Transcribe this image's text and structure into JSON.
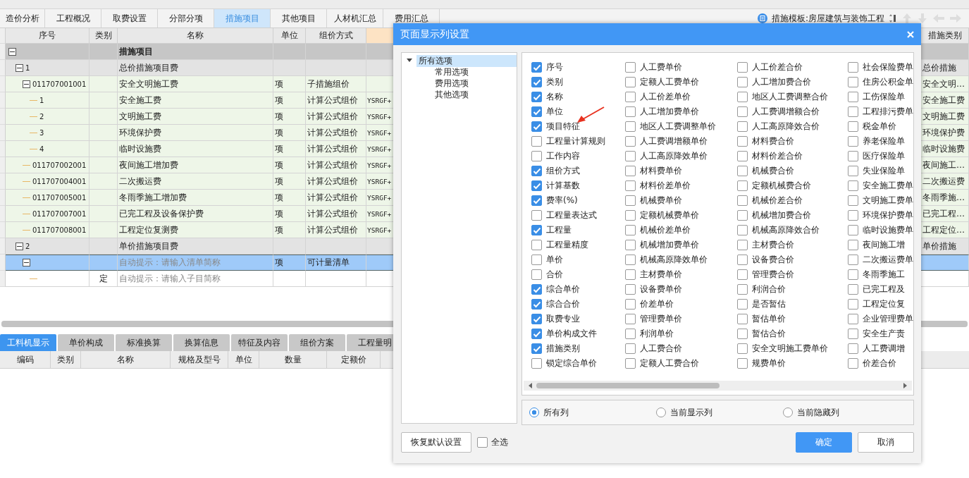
{
  "tabs": [
    {
      "label": "造价分析",
      "selected": false
    },
    {
      "label": "工程概况",
      "selected": false
    },
    {
      "label": "取费设置",
      "selected": false
    },
    {
      "label": "分部分项",
      "selected": false
    },
    {
      "label": "措施项目",
      "selected": true
    },
    {
      "label": "其他项目",
      "selected": false
    },
    {
      "label": "人材机汇总",
      "selected": false
    },
    {
      "label": "费用汇总",
      "selected": false
    }
  ],
  "template": {
    "label": "措施模板:房屋建筑与装饰工程"
  },
  "table": {
    "columns": [
      "序号",
      "类别",
      "名称",
      "单位",
      "组价方式",
      "措施类别"
    ],
    "rows": [
      {
        "name": "措施项目",
        "kind": "section",
        "expanded": true,
        "selected": false,
        "children": [
          {
            "seq": "1",
            "name": "总价措施项目费",
            "category": "总价措施",
            "kind": "group",
            "expanded": true,
            "selected": false,
            "children": [
              {
                "seq": "011707001001",
                "name": "安全文明施工费",
                "unit": "项",
                "method": "子措施组价",
                "category": "安全文明…",
                "kind": "item",
                "expanded": true,
                "selected": false,
                "children": [
                  {
                    "seq": "1",
                    "name": "安全施工费",
                    "unit": "项",
                    "method": "计算公式组价",
                    "formula": "YSRGF+",
                    "category": "安全施工费",
                    "kind": "item",
                    "selected": false
                  },
                  {
                    "seq": "2",
                    "name": "文明施工费",
                    "unit": "项",
                    "method": "计算公式组价",
                    "formula": "YSRGF+",
                    "category": "文明施工费",
                    "kind": "item",
                    "selected": false
                  },
                  {
                    "seq": "3",
                    "name": "环境保护费",
                    "unit": "项",
                    "method": "计算公式组价",
                    "formula": "YSRGF+",
                    "category": "环境保护费",
                    "kind": "item",
                    "selected": false
                  },
                  {
                    "seq": "4",
                    "name": "临时设施费",
                    "unit": "项",
                    "method": "计算公式组价",
                    "formula": "YSRGF+",
                    "category": "临时设施费",
                    "kind": "item",
                    "selected": false
                  }
                ]
              },
              {
                "seq": "011707002001",
                "name": "夜间施工增加费",
                "unit": "项",
                "method": "计算公式组价",
                "formula": "YSRGF+",
                "category": "夜间施工…",
                "kind": "item",
                "selected": false
              },
              {
                "seq": "011707004001",
                "name": "二次搬运费",
                "unit": "项",
                "method": "计算公式组价",
                "formula": "YSRGF+",
                "category": "二次搬运费",
                "kind": "item",
                "selected": false
              },
              {
                "seq": "011707005001",
                "name": "冬雨季施工增加费",
                "unit": "项",
                "method": "计算公式组价",
                "formula": "YSRGF+",
                "category": "冬雨季施…",
                "kind": "item",
                "selected": false
              },
              {
                "seq": "011707007001",
                "name": "已完工程及设备保护费",
                "unit": "项",
                "method": "计算公式组价",
                "formula": "YSRGF+",
                "category": "已完工程…",
                "kind": "item",
                "selected": false
              },
              {
                "seq": "011707008001",
                "name": "工程定位复测费",
                "unit": "项",
                "method": "计算公式组价",
                "formula": "YSRGF+",
                "category": "工程定位…",
                "kind": "item",
                "selected": false
              }
            ]
          },
          {
            "seq": "2",
            "name": "单价措施项目费",
            "category": "单价措施",
            "kind": "group",
            "expanded": true,
            "selected": false,
            "children": [
              {
                "placeholder": "自动提示：请输入清单简称",
                "unit": "项",
                "method": "可计量清单",
                "kind": "entry",
                "expanded": true,
                "selected": true,
                "children": [
                  {
                    "type": "定",
                    "placeholder": "自动提示：请输入子目简称",
                    "kind": "entry",
                    "selected": false
                  }
                ]
              }
            ]
          }
        ]
      }
    ]
  },
  "bottom_tabs": [
    {
      "label": "工料机显示",
      "selected": true
    },
    {
      "label": "单价构成",
      "selected": false
    },
    {
      "label": "标准换算",
      "selected": false
    },
    {
      "label": "换算信息",
      "selected": false
    },
    {
      "label": "特征及内容",
      "selected": false
    },
    {
      "label": "组价方案",
      "selected": false
    },
    {
      "label": "工程量明",
      "selected": false
    }
  ],
  "bottom_columns": [
    "编码",
    "类别",
    "名称",
    "规格及型号",
    "单位",
    "数量",
    "定额价"
  ],
  "dialog": {
    "title": "页面显示列设置",
    "tree": [
      {
        "label": "所有选项",
        "expanded": true,
        "selected": true,
        "children": [
          {
            "label": "常用选项",
            "selected": false
          },
          {
            "label": "费用选项",
            "selected": false
          },
          {
            "label": "其他选项",
            "selected": false
          }
        ]
      }
    ],
    "option_columns": [
      {
        "items": [
          {
            "label": "序号",
            "checked": true
          },
          {
            "label": "类别",
            "checked": true
          },
          {
            "label": "名称",
            "checked": true
          },
          {
            "label": "单位",
            "checked": true
          },
          {
            "label": "项目特征",
            "checked": true
          },
          {
            "label": "工程量计算规则",
            "checked": false
          },
          {
            "label": "工作内容",
            "checked": false
          },
          {
            "label": "组价方式",
            "checked": true
          },
          {
            "label": "计算基数",
            "checked": true
          },
          {
            "label": "费率(%)",
            "checked": true
          },
          {
            "label": "工程量表达式",
            "checked": false
          },
          {
            "label": "工程量",
            "checked": true
          },
          {
            "label": "工程量精度",
            "checked": false
          },
          {
            "label": "单价",
            "checked": false
          },
          {
            "label": "合价",
            "checked": false
          },
          {
            "label": "综合单价",
            "checked": true
          },
          {
            "label": "综合合价",
            "checked": true
          },
          {
            "label": "取费专业",
            "checked": true
          },
          {
            "label": "单价构成文件",
            "checked": true
          },
          {
            "label": "措施类别",
            "checked": true
          },
          {
            "label": "锁定综合单价",
            "checked": false
          }
        ]
      },
      {
        "items": [
          {
            "label": "人工费单价",
            "checked": false
          },
          {
            "label": "定额人工费单价",
            "checked": false
          },
          {
            "label": "人工价差单价",
            "checked": false
          },
          {
            "label": "人工增加费单价",
            "checked": false
          },
          {
            "label": "地区人工费调整单价",
            "checked": false
          },
          {
            "label": "人工费调增额单价",
            "checked": false
          },
          {
            "label": "人工高原降效单价",
            "checked": false
          },
          {
            "label": "材料费单价",
            "checked": false
          },
          {
            "label": "材料价差单价",
            "checked": false
          },
          {
            "label": "机械费单价",
            "checked": false
          },
          {
            "label": "定额机械费单价",
            "checked": false
          },
          {
            "label": "机械价差单价",
            "checked": false
          },
          {
            "label": "机械增加费单价",
            "checked": false
          },
          {
            "label": "机械高原降效单价",
            "checked": false
          },
          {
            "label": "主材费单价",
            "checked": false
          },
          {
            "label": "设备费单价",
            "checked": false
          },
          {
            "label": "价差单价",
            "checked": false
          },
          {
            "label": "管理费单价",
            "checked": false
          },
          {
            "label": "利润单价",
            "checked": false
          },
          {
            "label": "人工费合价",
            "checked": false
          },
          {
            "label": "定额人工费合价",
            "checked": false
          }
        ]
      },
      {
        "items": [
          {
            "label": "人工价差合价",
            "checked": false
          },
          {
            "label": "人工增加费合价",
            "checked": false
          },
          {
            "label": "地区人工费调整合价",
            "checked": false
          },
          {
            "label": "人工费调增额合价",
            "checked": false
          },
          {
            "label": "人工高原降效合价",
            "checked": false
          },
          {
            "label": "材料费合价",
            "checked": false
          },
          {
            "label": "材料价差合价",
            "checked": false
          },
          {
            "label": "机械费合价",
            "checked": false
          },
          {
            "label": "定额机械费合价",
            "checked": false
          },
          {
            "label": "机械价差合价",
            "checked": false
          },
          {
            "label": "机械增加费合价",
            "checked": false
          },
          {
            "label": "机械高原降效合价",
            "checked": false
          },
          {
            "label": "主材费合价",
            "checked": false
          },
          {
            "label": "设备费合价",
            "checked": false
          },
          {
            "label": "管理费合价",
            "checked": false
          },
          {
            "label": "利润合价",
            "checked": false
          },
          {
            "label": "是否暂估",
            "checked": false
          },
          {
            "label": "暂估单价",
            "checked": false
          },
          {
            "label": "暂估合价",
            "checked": false
          },
          {
            "label": "安全文明施工费单价",
            "checked": false
          },
          {
            "label": "规费单价",
            "checked": false
          }
        ]
      },
      {
        "items": [
          {
            "label": "社会保险费单",
            "checked": false
          },
          {
            "label": "住房公积金单",
            "checked": false
          },
          {
            "label": "工伤保险单",
            "checked": false
          },
          {
            "label": "工程排污费单",
            "checked": false
          },
          {
            "label": "税金单价",
            "checked": false
          },
          {
            "label": "养老保险单",
            "checked": false
          },
          {
            "label": "医疗保险单",
            "checked": false
          },
          {
            "label": "失业保险单",
            "checked": false
          },
          {
            "label": "安全施工费单",
            "checked": false
          },
          {
            "label": "文明施工费单",
            "checked": false
          },
          {
            "label": "环境保护费单",
            "checked": false
          },
          {
            "label": "临时设施费单",
            "checked": false
          },
          {
            "label": "夜间施工增",
            "checked": false
          },
          {
            "label": "二次搬运费单",
            "checked": false
          },
          {
            "label": "冬雨季施工",
            "checked": false
          },
          {
            "label": "已完工程及",
            "checked": false
          },
          {
            "label": "工程定位复",
            "checked": false
          },
          {
            "label": "企业管理费单",
            "checked": false
          },
          {
            "label": "安全生产责",
            "checked": false
          },
          {
            "label": "人工费调增",
            "checked": false
          },
          {
            "label": "价差合价",
            "checked": false
          }
        ]
      }
    ],
    "radios": [
      {
        "label": "所有列",
        "selected": true
      },
      {
        "label": "当前显示列",
        "selected": false
      },
      {
        "label": "当前隐藏列",
        "selected": false
      }
    ],
    "reset_button": "恢复默认设置",
    "select_all": {
      "label": "全选",
      "checked": false
    },
    "ok_button": "确定",
    "cancel_button": "取消"
  }
}
